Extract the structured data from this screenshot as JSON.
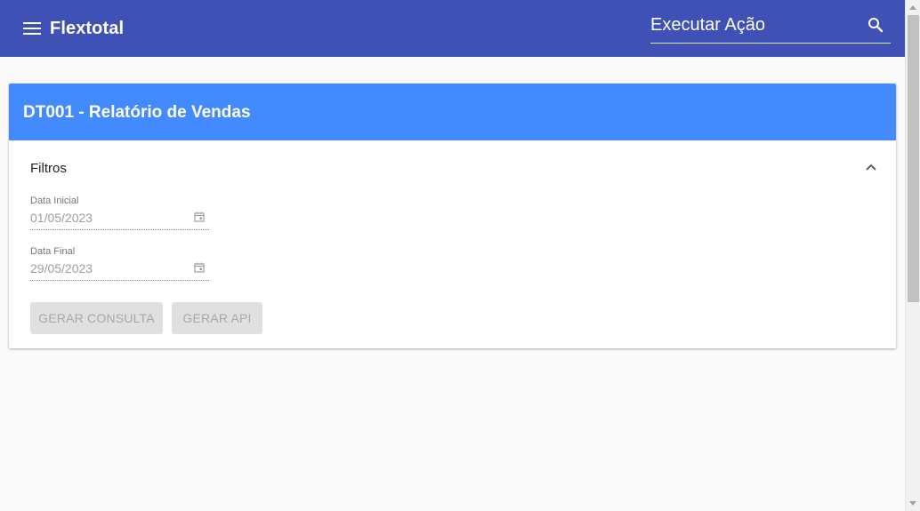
{
  "topbar": {
    "app_title": "Flextotal",
    "menu_icon": "menu-icon",
    "search": {
      "placeholder": "Executar Ação",
      "value": "",
      "icon": "search-icon"
    },
    "background_color": "#3f51b5"
  },
  "report": {
    "title": "DT001 - Relatório de Vendas",
    "header_color": "#448aff",
    "filters": {
      "title": "Filtros",
      "expanded": true,
      "toggle_icon": "chevron-up-icon",
      "start_date": {
        "label": "Data Inicial",
        "value": "01/05/2023",
        "icon": "calendar-icon"
      },
      "end_date": {
        "label": "Data Final",
        "value": "29/05/2023",
        "icon": "calendar-icon"
      }
    },
    "actions": {
      "generate_query_label": "GERAR CONSULTA",
      "generate_api_label": "GERAR API",
      "disabled": true
    }
  }
}
